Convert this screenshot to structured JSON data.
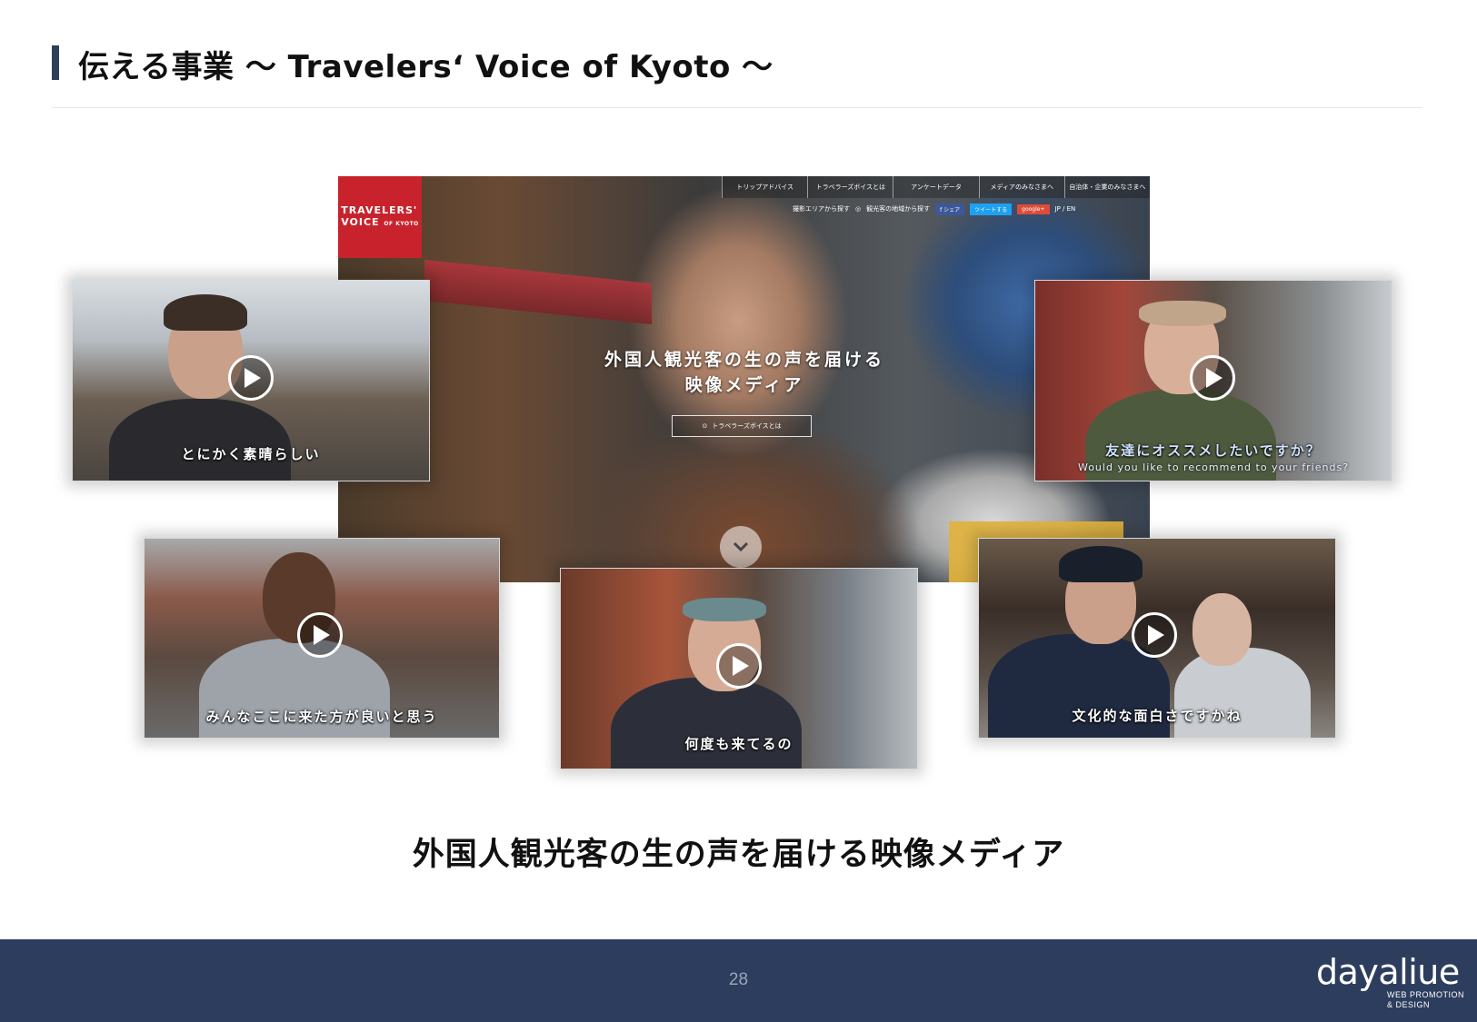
{
  "header": {
    "title": "伝える事業 〜 Travelers‘ Voice of Kyoto 〜"
  },
  "website": {
    "logo_line1": "TRAVELERS'",
    "logo_line2": "VOICE",
    "logo_small": "OF KYOTO",
    "nav": [
      "トリップアドバイス",
      "トラベラーズボイスとは",
      "アンケートデータ",
      "メディアのみなさまへ",
      "自治体・企業のみなさまへ"
    ],
    "subnav_area": "撮影エリアから探す",
    "subnav_region": "観光客の地域から探す",
    "share_fb": "f シェア",
    "share_tw": "ツイートする",
    "share_gp": "google+",
    "lang": "JP / EN",
    "tagline_line1": "外国人観光客の生の声を届ける",
    "tagline_line2": "映像メディア",
    "about_button": "トラベラーズボイスとは"
  },
  "videos": [
    {
      "caption": "とにかく素晴らしい"
    },
    {
      "caption": "友達にオススメしたいですか？",
      "caption_en": "Would you like to recommend to your friends?"
    },
    {
      "caption": "みんなここに来た方が良いと思う"
    },
    {
      "caption": "何度も来てるの"
    },
    {
      "caption": "文化的な面白さですかね"
    }
  ],
  "subtitle": "外国人観光客の生の声を届ける映像メディア",
  "footer": {
    "page_number": "28",
    "brand_name": "dayaliue",
    "brand_tag_line1": "WEB PROMOTION",
    "brand_tag_line2": "& DESIGN"
  },
  "colors": {
    "accent_navy": "#2c3e5c",
    "footer_bg": "#2d3d5e",
    "logo_red": "#c8232c"
  }
}
